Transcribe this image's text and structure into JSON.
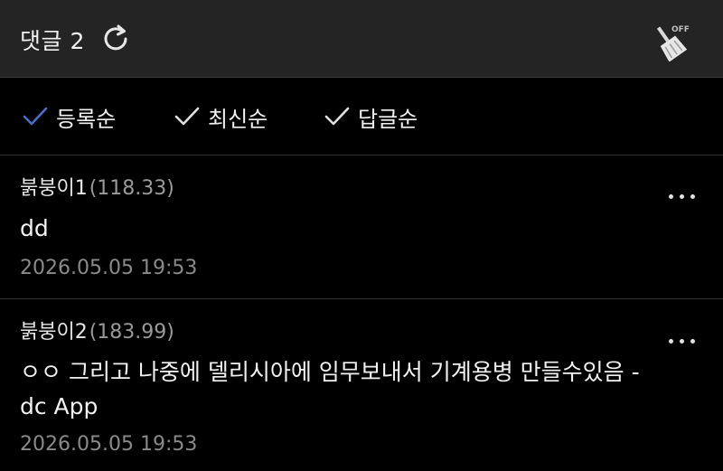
{
  "header": {
    "title": "댓글 2",
    "icons": {
      "refresh": "refresh-icon",
      "clean_bot": "broom-off-icon"
    },
    "clean_bot_badge": "OFF"
  },
  "sort": {
    "options": [
      {
        "label": "등록순",
        "selected": true
      },
      {
        "label": "최신순",
        "selected": false
      },
      {
        "label": "답글순",
        "selected": false
      }
    ],
    "colors": {
      "selected_check": "#4a6fc9",
      "unselected_check": "#e0e0e0"
    }
  },
  "comments": [
    {
      "author": "붉붕이1",
      "ip": "(118.33)",
      "text": "dd",
      "date": "2026.05.05 19:53"
    },
    {
      "author": "붉붕이2",
      "ip": "(183.99)",
      "text_line1": "ㅇㅇ 그리고 나중에 델리시아에 임무보내서 기계용병 만들수있음 -",
      "text_line2": "dc App",
      "date": "2026.05.05 19:53"
    }
  ],
  "colors": {
    "header_bg": "#242424",
    "page_bg": "#000000",
    "text": "#f0f0f0",
    "muted": "#8a8a8a"
  }
}
